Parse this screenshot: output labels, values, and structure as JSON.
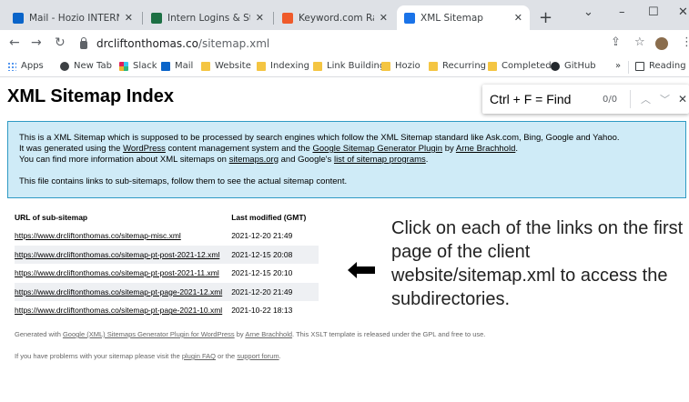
{
  "tabs": [
    {
      "title": "Mail - Hozio INTERN - O",
      "favicon_color": "#0a64c9",
      "active": false
    },
    {
      "title": "Intern Logins & Stuff.xlsx",
      "favicon_color": "#1d7044",
      "active": false
    },
    {
      "title": "Keyword.com Ranking Re",
      "favicon_color": "#ef5a2a",
      "active": false
    },
    {
      "title": "XML Sitemap",
      "favicon_color": "#1a73e8",
      "active": true
    }
  ],
  "toolbar": {
    "url_host": "drcliftonthomas.co",
    "url_path": "/sitemap.xml"
  },
  "bookmarks": [
    {
      "label": "Apps",
      "icon": "apps-grid-icon"
    },
    {
      "label": "New Tab",
      "icon": "chrome-icon"
    },
    {
      "label": "Slack",
      "icon": "slack-icon"
    },
    {
      "label": "Mail",
      "icon": "outlook-icon"
    },
    {
      "label": "Website",
      "icon": "folder-icon"
    },
    {
      "label": "Indexing",
      "icon": "folder-icon"
    },
    {
      "label": "Link Building",
      "icon": "folder-icon"
    },
    {
      "label": "Hozio",
      "icon": "folder-icon"
    },
    {
      "label": "Recurring",
      "icon": "folder-icon"
    },
    {
      "label": "Completed",
      "icon": "folder-icon"
    },
    {
      "label": "GitHub",
      "icon": "github-icon"
    }
  ],
  "reading_list": "Reading list",
  "page": {
    "title": "XML Sitemap Index",
    "intro_1a": "This is a XML Sitemap which is supposed to be processed by search engines which follow the XML Sitemap standard like Ask.com, Bing, Google and Yahoo.",
    "intro_1b_pre": "It was generated using the ",
    "intro_1b_link1": "WordPress",
    "intro_1b_mid": " content management system and the ",
    "intro_1b_link2": "Google Sitemap Generator Plugin",
    "intro_1b_by": " by ",
    "intro_1b_link3": "Arne Brachhold",
    "intro_1b_end": ".",
    "intro_1c_pre": "You can find more information about XML sitemaps on ",
    "intro_1c_link1": "sitemaps.org",
    "intro_1c_mid": " and Google's ",
    "intro_1c_link2": "list of sitemap programs",
    "intro_1c_end": ".",
    "intro_2": "This file contains links to sub-sitemaps, follow them to see the actual sitemap content.",
    "col_url": "URL of sub-sitemap",
    "col_modified": "Last modified (GMT)",
    "rows": [
      {
        "url": "https://www.drcliftonthomas.co/sitemap-misc.xml",
        "modified": "2021-12-20 21:49"
      },
      {
        "url": "https://www.drcliftonthomas.co/sitemap-pt-post-2021-12.xml",
        "modified": "2021-12-15 20:08"
      },
      {
        "url": "https://www.drcliftonthomas.co/sitemap-pt-post-2021-11.xml",
        "modified": "2021-12-15 20:10"
      },
      {
        "url": "https://www.drcliftonthomas.co/sitemap-pt-page-2021-12.xml",
        "modified": "2021-12-20 21:49"
      },
      {
        "url": "https://www.drcliftonthomas.co/sitemap-pt-page-2021-10.xml",
        "modified": "2021-10-22 18:13"
      }
    ],
    "footer1_pre": "Generated with ",
    "footer1_link1": "Google (XML) Sitemaps Generator Plugin for WordPress",
    "footer1_by": " by ",
    "footer1_link2": "Arne Brachhold",
    "footer1_end": ". This XSLT template is released under the GPL and free to use.",
    "footer2_pre": "If you have problems with your sitemap please visit the ",
    "footer2_link1": "plugin FAQ",
    "footer2_mid": " or the ",
    "footer2_link2": "support forum",
    "footer2_end": "."
  },
  "findbar": {
    "query": "Ctrl + F = Find",
    "count": "0/0"
  },
  "annotation": "Click on each of the links on the first page of the client website/sitemap.xml to access the subdirectories."
}
